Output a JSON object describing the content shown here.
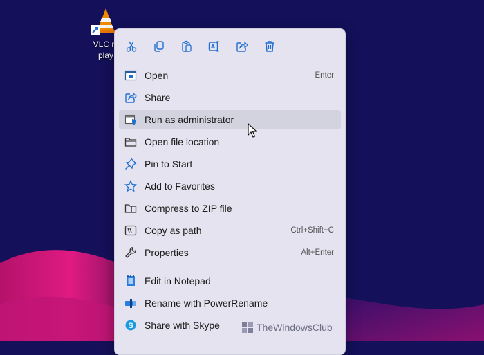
{
  "desktop": {
    "icon_label_line1": "VLC m",
    "icon_label_line2": "play",
    "app_icon": "vlc-cone-icon"
  },
  "toolbar": [
    {
      "name": "cut",
      "icon": "scissors-icon"
    },
    {
      "name": "copy",
      "icon": "copy-icon"
    },
    {
      "name": "paste",
      "icon": "clipboard-icon"
    },
    {
      "name": "rename",
      "icon": "rename-icon"
    },
    {
      "name": "share",
      "icon": "share-icon"
    },
    {
      "name": "delete",
      "icon": "trash-icon"
    }
  ],
  "menu": {
    "items": [
      {
        "label": "Open",
        "shortcut": "Enter",
        "icon": "open-icon"
      },
      {
        "label": "Share",
        "shortcut": "",
        "icon": "share-icon"
      },
      {
        "label": "Run as administrator",
        "shortcut": "",
        "icon": "shield-window-icon",
        "hovered": true
      },
      {
        "label": "Open file location",
        "shortcut": "",
        "icon": "folder-icon"
      },
      {
        "label": "Pin to Start",
        "shortcut": "",
        "icon": "pin-icon"
      },
      {
        "label": "Add to Favorites",
        "shortcut": "",
        "icon": "star-icon"
      },
      {
        "label": "Compress to ZIP file",
        "shortcut": "",
        "icon": "zip-folder-icon"
      },
      {
        "label": "Copy as path",
        "shortcut": "Ctrl+Shift+C",
        "icon": "path-icon"
      },
      {
        "label": "Properties",
        "shortcut": "Alt+Enter",
        "icon": "wrench-icon"
      }
    ],
    "extra_items": [
      {
        "label": "Edit in Notepad",
        "icon": "notepad-icon"
      },
      {
        "label": "Rename with PowerRename",
        "icon": "powerrename-icon"
      },
      {
        "label": "Share with Skype",
        "icon": "skype-icon"
      }
    ]
  },
  "watermark": {
    "text": "TheWindowsClub",
    "icon": "twc-logo-icon"
  },
  "colors": {
    "desktop_bg": "#14105a",
    "wave": "#d4147a",
    "menu_bg": "#e4e3ef",
    "hover_bg": "#d3d2df",
    "icon_blue": "#1f6fd0"
  }
}
